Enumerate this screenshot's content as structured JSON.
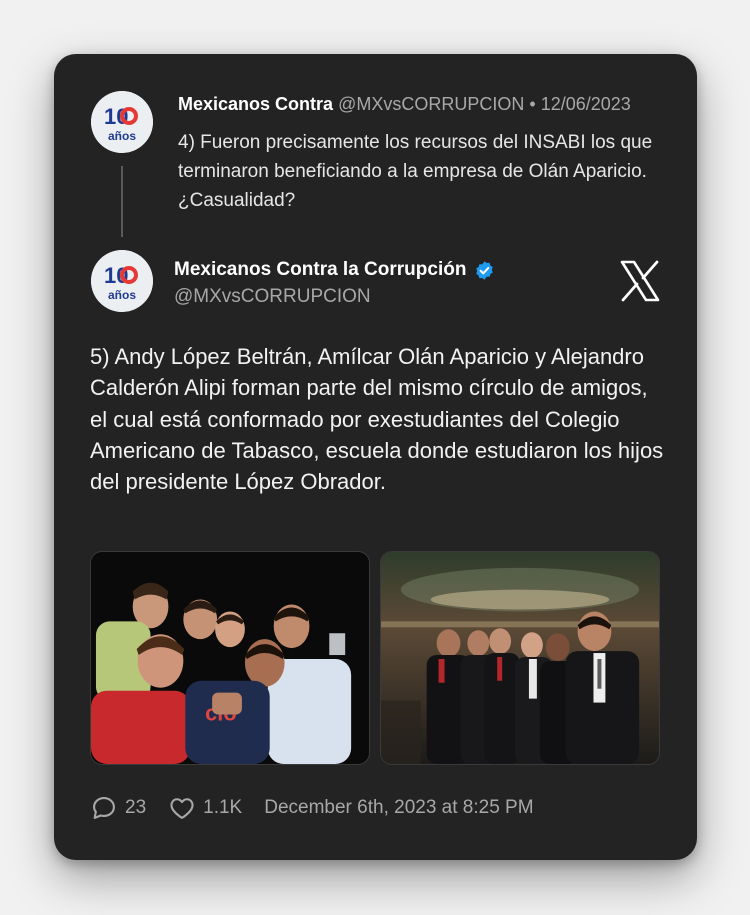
{
  "reply": {
    "name": "Mexicanos Contra",
    "handle": "@MXvsCORRUPCION",
    "separator": "•",
    "date": "12/06/2023",
    "text": "4) Fueron precisamente los recursos del INSABI los que terminaron beneficiando a la empresa de Olán Aparicio. ¿Casualidad?"
  },
  "main": {
    "name": "Mexicanos Contra la Corrupción",
    "handle": "@MXvsCORRUPCION",
    "text": "5) Andy López Beltrán, Amílcar Olán Aparicio y Alejandro Calderón Alipi forman parte del mismo círculo de amigos, el cual está conformado por exestudiantes del Colegio Americano de Tabasco, escuela donde estudiaron los hijos del presidente López Obrador."
  },
  "avatar": {
    "number": "10",
    "label": "años",
    "brand_color": "#1f3a93",
    "accent_color": "#e53935"
  },
  "footer": {
    "comments": "23",
    "likes": "1.1K",
    "timestamp": "December 6th, 2023 at 8:25 PM"
  },
  "icons": {
    "verified": "verified-badge-icon",
    "x_logo": "x-logo-icon",
    "comment": "comment-icon",
    "like": "heart-icon"
  },
  "colors": {
    "card_bg": "#232323",
    "page_bg": "#f1f1f1",
    "verified_blue": "#1d9bf0",
    "muted_text": "#a8a8a8"
  }
}
